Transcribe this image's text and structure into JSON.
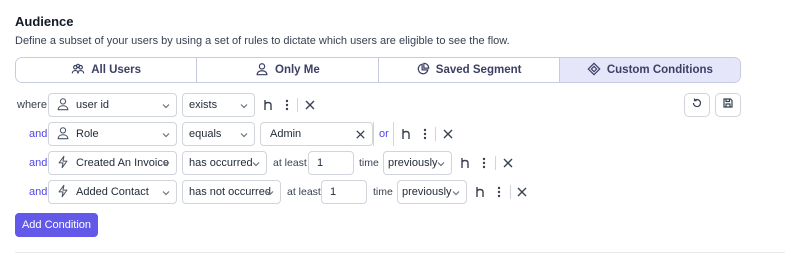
{
  "section": {
    "title": "Audience",
    "description": "Define a subset of your users by using a set of rules to dictate which users are eligible to see the flow."
  },
  "tabs": [
    {
      "label": "All Users",
      "icon": "users-icon",
      "active": false
    },
    {
      "label": "Only Me",
      "icon": "user-icon",
      "active": false
    },
    {
      "label": "Saved Segment",
      "icon": "pie-chart-icon",
      "active": false
    },
    {
      "label": "Custom Conditions",
      "icon": "diamond-icon",
      "active": true
    }
  ],
  "conditions": [
    {
      "connector": "where",
      "field": "user id",
      "field_icon": "user-icon",
      "operator": "exists"
    },
    {
      "connector": "and",
      "field": "Role",
      "field_icon": "user-icon",
      "operator": "equals",
      "value": "Admin",
      "or_label": "or"
    },
    {
      "connector": "and",
      "field": "Created An Invoice",
      "field_icon": "lightning-icon",
      "operator": "has occurred",
      "at_least_label": "at least",
      "count": "1",
      "time_label": "time",
      "time_value": "previously"
    },
    {
      "connector": "and",
      "field": "Added Contact",
      "field_icon": "lightning-icon",
      "operator": "has not occurred",
      "at_least_label": "at least",
      "count": "1",
      "time_label": "time",
      "time_value": "previously"
    }
  ],
  "add_condition_label": "Add Condition",
  "colors": {
    "accent": "#6259e8",
    "connector": "#4f46e5",
    "active_tab": "#e6e6fb",
    "border": "#d1d5db"
  }
}
